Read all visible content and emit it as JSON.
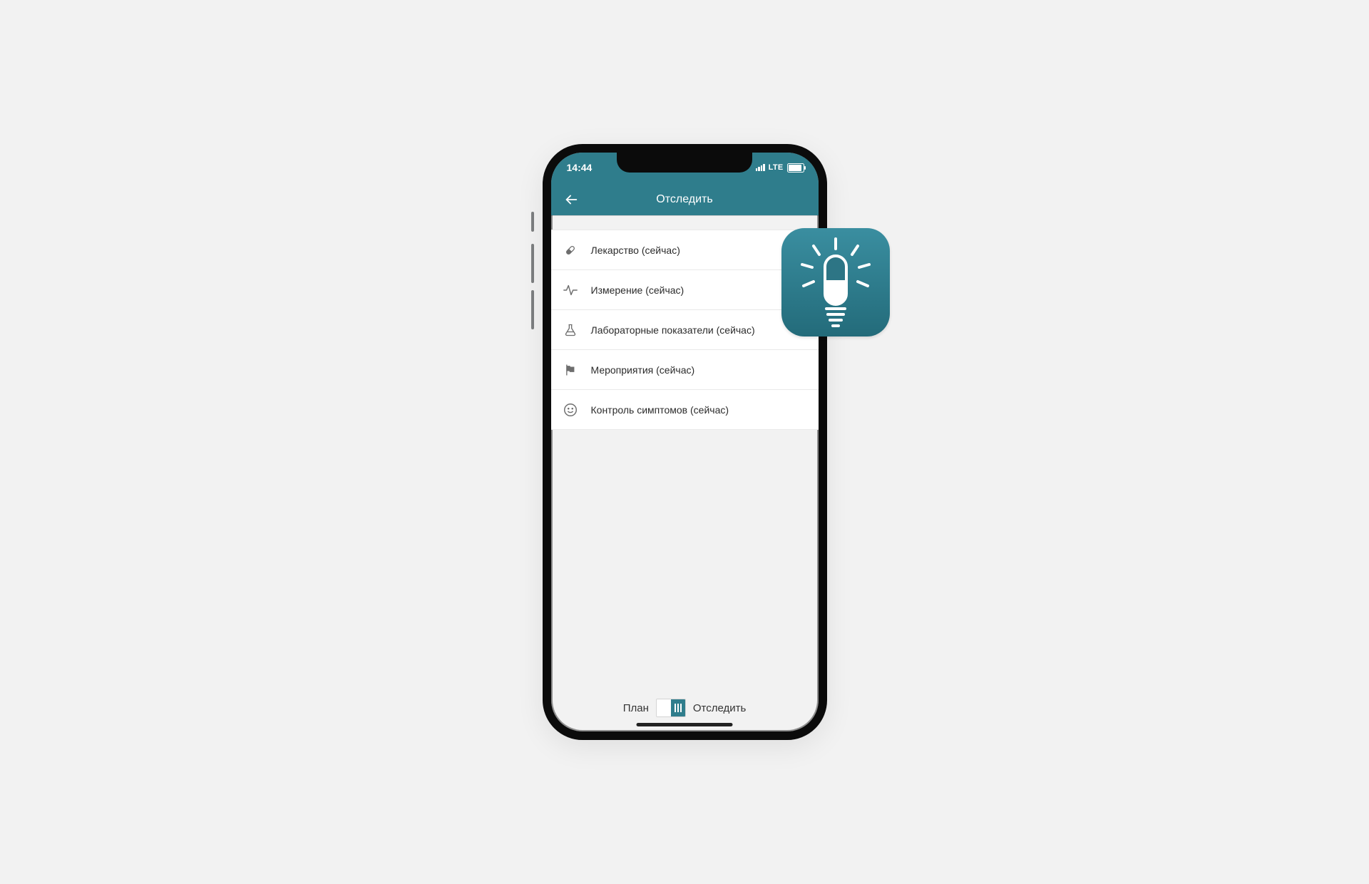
{
  "status": {
    "time": "14:44",
    "carrier_mode": "LTE"
  },
  "nav": {
    "title": "Отследить"
  },
  "list": {
    "items": [
      {
        "label": "Лекарство (сейчас)"
      },
      {
        "label": "Измерение (сейчас)"
      },
      {
        "label": "Лабораторные показатели (сейчас)"
      },
      {
        "label": "Мероприятия (сейчас)"
      },
      {
        "label": "Контроль симптомов (сейчас)"
      }
    ]
  },
  "toggle": {
    "left_label": "План",
    "right_label": "Отследить"
  },
  "colors": {
    "teal": "#2f7d8c"
  }
}
